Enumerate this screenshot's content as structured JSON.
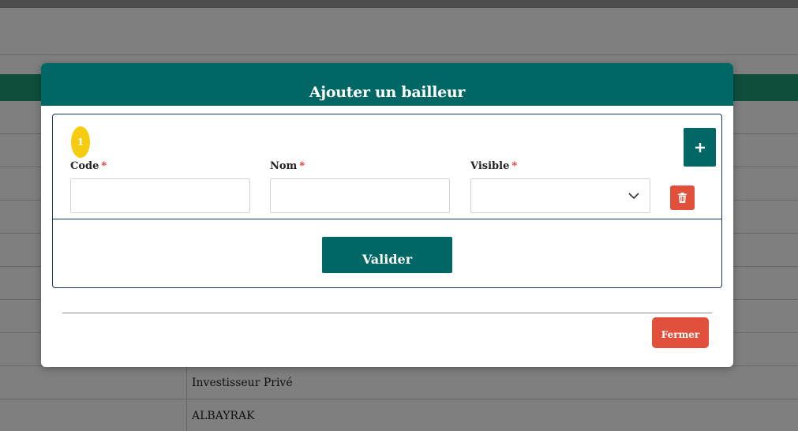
{
  "modal": {
    "title": "Ajouter un bailleur",
    "row_index": "1",
    "fields": {
      "code": {
        "label": "Code",
        "required_mark": "*",
        "value": ""
      },
      "nom": {
        "label": "Nom",
        "required_mark": "*",
        "value": ""
      },
      "visible": {
        "label": "Visible",
        "required_mark": "*",
        "selected": ""
      }
    },
    "add_icon": "plus-icon",
    "delete_icon": "trash-icon",
    "submit_label": "Valider",
    "close_label": "Fermer"
  },
  "background": {
    "rows": [
      "",
      "",
      "",
      "",
      "",
      "",
      "",
      "",
      "Investisseur Privé",
      "ALBAYRAK"
    ]
  },
  "colors": {
    "primary": "#006764",
    "danger": "#e0503a",
    "badge": "#f5cc10",
    "accent_green": "#1e9c78"
  }
}
